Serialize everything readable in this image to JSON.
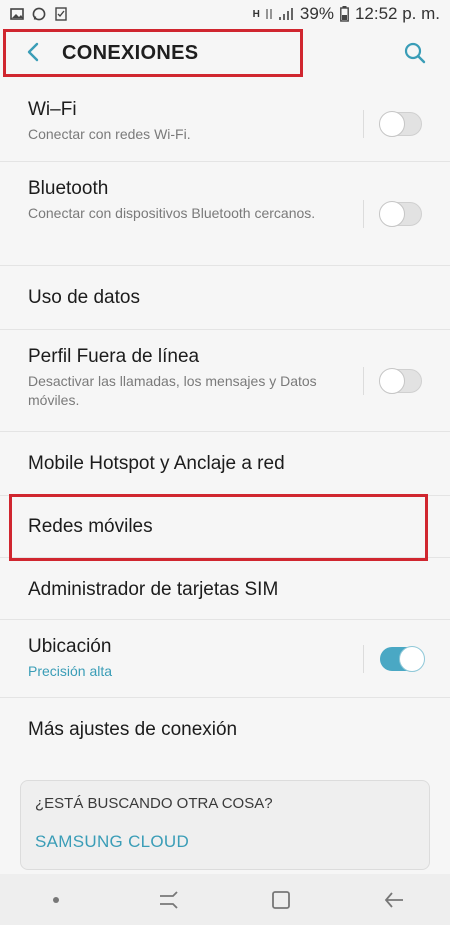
{
  "status_bar": {
    "battery": "39%",
    "time": "12:52 p. m.",
    "network": "H"
  },
  "header": {
    "title": "CONEXIONES"
  },
  "items": [
    {
      "label": "Wi–Fi",
      "sub": "Conectar con redes Wi-Fi.",
      "toggle": "off"
    },
    {
      "label": "Bluetooth",
      "sub": "Conectar con dispositivos Bluetooth cercanos.",
      "toggle": "off"
    },
    {
      "label": "Uso de datos"
    },
    {
      "label": "Perfil Fuera de línea",
      "sub": "Desactivar las llamadas, los mensajes y Datos móviles.",
      "toggle": "off"
    },
    {
      "label": "Mobile Hotspot y Anclaje a red"
    },
    {
      "label": "Redes móviles"
    },
    {
      "label": "Administrador de tarjetas SIM"
    },
    {
      "label": "Ubicación",
      "sub": "Precisión alta",
      "toggle": "on"
    },
    {
      "label": "Más ajustes de conexión"
    }
  ],
  "card": {
    "title": "¿ESTÁ BUSCANDO OTRA COSA?",
    "link": "SAMSUNG CLOUD"
  },
  "colors": {
    "accent": "#3a9db7",
    "highlight": "#d0262f",
    "toggle_on": "#4aa8c4"
  },
  "icons": {
    "back": "back-arrow-icon",
    "search": "search-icon"
  }
}
